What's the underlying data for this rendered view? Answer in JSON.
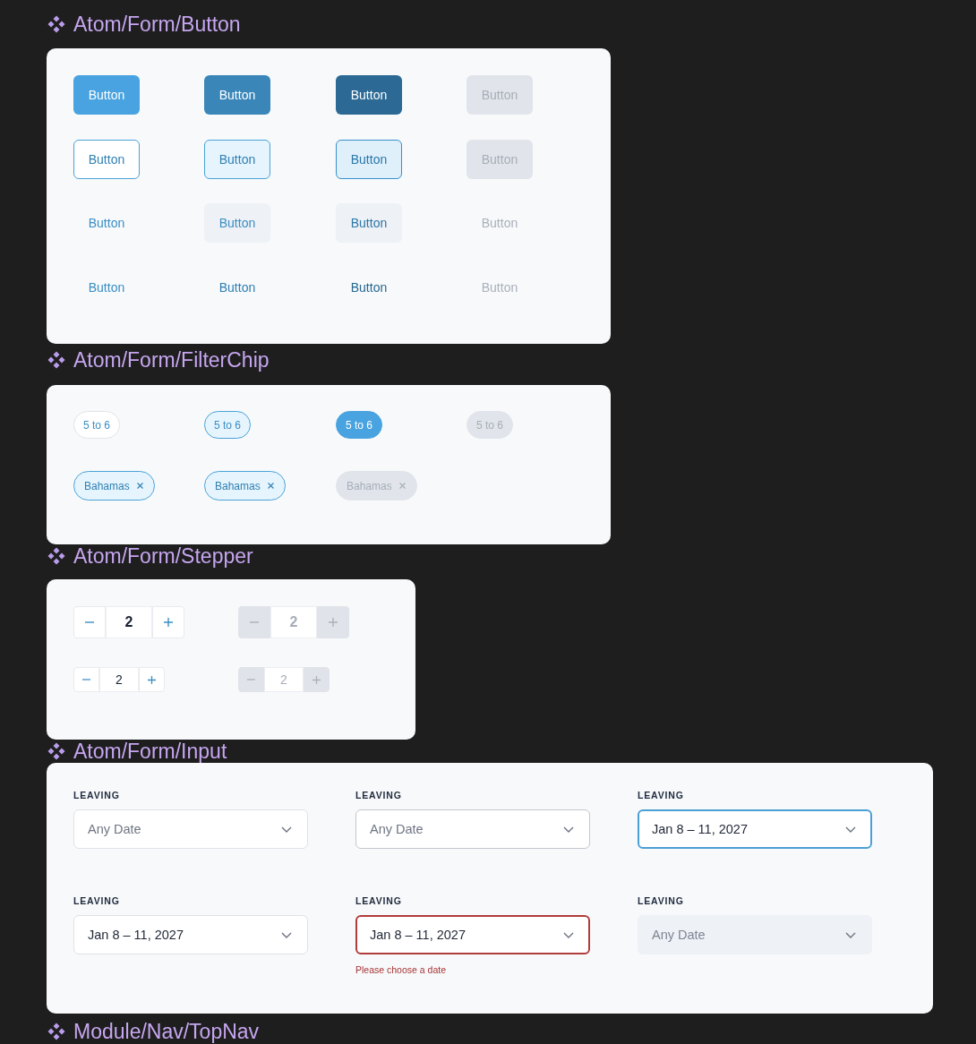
{
  "button_section": {
    "title": "Atom/Form/Button",
    "rows": [
      {
        "kind": "primary",
        "buttons": [
          {
            "label": "Button",
            "hovered": false,
            "pressed": false,
            "disabled": false
          },
          {
            "label": "Button",
            "hovered": true,
            "pressed": false,
            "disabled": false
          },
          {
            "label": "Button",
            "hovered": false,
            "pressed": true,
            "disabled": false
          },
          {
            "label": "Button",
            "hovered": false,
            "pressed": false,
            "disabled": true
          }
        ]
      },
      {
        "kind": "secondary",
        "buttons": [
          {
            "label": "Button",
            "hovered": false,
            "pressed": false,
            "disabled": false
          },
          {
            "label": "Button",
            "hovered": true,
            "pressed": false,
            "disabled": false
          },
          {
            "label": "Button",
            "hovered": false,
            "pressed": true,
            "disabled": false
          },
          {
            "label": "Button",
            "hovered": false,
            "pressed": false,
            "disabled": true
          }
        ]
      },
      {
        "kind": "tertiary",
        "buttons": [
          {
            "label": "Button",
            "hovered": false,
            "pressed": false,
            "disabled": false
          },
          {
            "label": "Button",
            "hovered": true,
            "pressed": false,
            "disabled": false
          },
          {
            "label": "Button",
            "hovered": false,
            "pressed": true,
            "disabled": false
          },
          {
            "label": "Button",
            "hovered": false,
            "pressed": false,
            "disabled": true
          }
        ]
      },
      {
        "kind": "link",
        "buttons": [
          {
            "label": "Button",
            "hovered": false,
            "pressed": false,
            "disabled": false
          },
          {
            "label": "Button",
            "hovered": true,
            "pressed": false,
            "disabled": false
          },
          {
            "label": "Button",
            "hovered": false,
            "pressed": true,
            "disabled": false
          },
          {
            "label": "Button",
            "hovered": false,
            "pressed": false,
            "disabled": true
          }
        ]
      }
    ]
  },
  "filterchip_section": {
    "title": "Atom/Form/FilterChip",
    "rows": [
      {
        "kind": "toggle",
        "chips": [
          {
            "label": "5 to 6",
            "hovered": false,
            "selected": false,
            "disabled": false
          },
          {
            "label": "5 to 6",
            "hovered": true,
            "selected": false,
            "disabled": false
          },
          {
            "label": "5 to 6",
            "hovered": false,
            "selected": true,
            "disabled": false
          },
          {
            "label": "5 to 6",
            "hovered": false,
            "selected": false,
            "disabled": true
          }
        ]
      },
      {
        "kind": "removable",
        "chips": [
          {
            "label": "Bahamas",
            "disabled": false
          },
          {
            "label": "Bahamas",
            "disabled": false
          },
          {
            "label": "Bahamas",
            "disabled": true
          }
        ]
      }
    ]
  },
  "stepper_section": {
    "title": "Atom/Form/Stepper",
    "rows": [
      {
        "kind": "large",
        "steppers": [
          {
            "value": "2",
            "disabled": false
          },
          {
            "value": "2",
            "disabled": true
          }
        ]
      },
      {
        "kind": "small",
        "steppers": [
          {
            "value": "2",
            "disabled": false
          },
          {
            "value": "2",
            "disabled": true
          }
        ]
      }
    ]
  },
  "input_section": {
    "title": "Atom/Form/Input",
    "fields": [
      {
        "label": "LEAVING",
        "placeholder": "Any Date",
        "hovered": false,
        "focused": false,
        "disabled": false
      },
      {
        "label": "LEAVING",
        "placeholder": "Any Date",
        "hovered": true,
        "focused": false,
        "disabled": false
      },
      {
        "label": "LEAVING",
        "value": "Jan 8 – 11, 2027",
        "hovered": false,
        "focused": true,
        "disabled": false
      },
      {
        "label": "LEAVING",
        "value": "Jan 8 – 11, 2027",
        "hovered": false,
        "focused": false,
        "disabled": false
      },
      {
        "label": "LEAVING",
        "value": "Jan 8 – 11, 2027",
        "hovered": false,
        "focused": false,
        "disabled": false,
        "error": "Please choose a date"
      },
      {
        "label": "LEAVING",
        "placeholder": "Any Date",
        "hovered": false,
        "focused": false,
        "disabled": true
      }
    ]
  },
  "next_section": {
    "title": "Module/Nav/TopNav"
  }
}
